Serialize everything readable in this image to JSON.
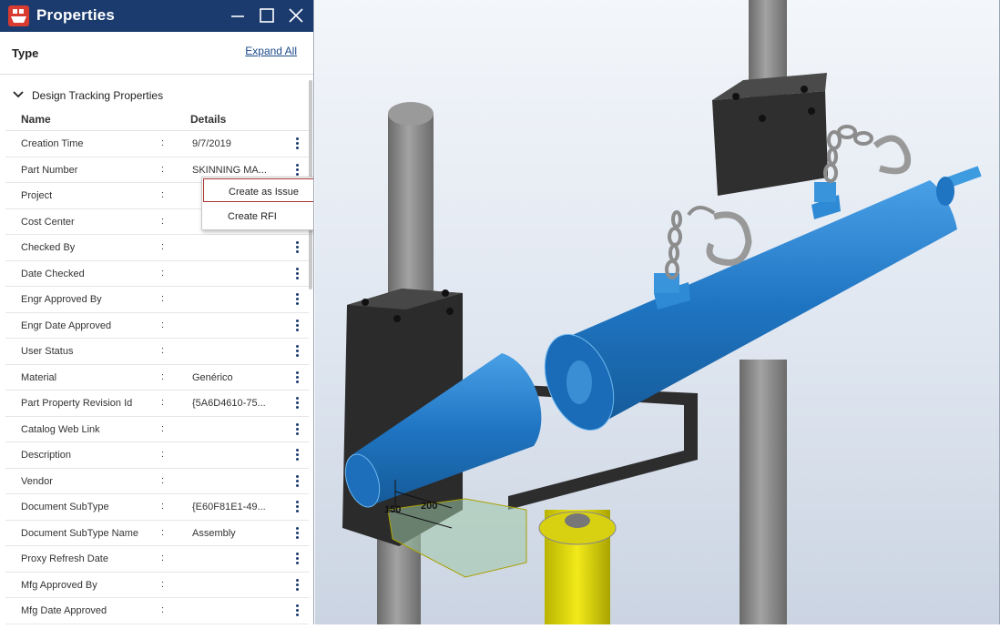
{
  "window": {
    "title": "Properties",
    "icon": "autodesk-app-icon",
    "controls": [
      "minimize-icon",
      "maximize-icon",
      "close-icon"
    ],
    "titlebar_color": "#1b3b6f"
  },
  "type_bar": {
    "label": "Type",
    "expand_all": "Expand All"
  },
  "section": {
    "title": "Design Tracking Properties",
    "expanded": true
  },
  "columns": {
    "name": "Name",
    "details": "Details"
  },
  "properties": [
    {
      "name": "Creation Time",
      "value": "9/7/2019"
    },
    {
      "name": "Part Number",
      "value": "SKINNING MA..."
    },
    {
      "name": "Project",
      "value": ""
    },
    {
      "name": "Cost Center",
      "value": ""
    },
    {
      "name": "Checked By",
      "value": ""
    },
    {
      "name": "Date Checked",
      "value": ""
    },
    {
      "name": "Engr Approved By",
      "value": ""
    },
    {
      "name": "Engr Date Approved",
      "value": ""
    },
    {
      "name": "User Status",
      "value": ""
    },
    {
      "name": "Material",
      "value": "Genérico"
    },
    {
      "name": "Part Property Revision Id",
      "value": "{5A6D4610-75..."
    },
    {
      "name": "Catalog Web Link",
      "value": ""
    },
    {
      "name": "Description",
      "value": ""
    },
    {
      "name": "Vendor",
      "value": ""
    },
    {
      "name": "Document SubType",
      "value": "{E60F81E1-49..."
    },
    {
      "name": "Document SubType Name",
      "value": "Assembly"
    },
    {
      "name": "Proxy Refresh Date",
      "value": ""
    },
    {
      "name": "Mfg Approved By",
      "value": ""
    },
    {
      "name": "Mfg Date Approved",
      "value": ""
    }
  ],
  "context_menu": {
    "items": [
      "Create as Issue",
      "Create RFI"
    ],
    "highlighted": "Create as Issue",
    "highlight_color": "#a73434"
  },
  "viewport": {
    "dimension_labels": [
      "150",
      "200"
    ],
    "model_color": "#1f75c2"
  }
}
